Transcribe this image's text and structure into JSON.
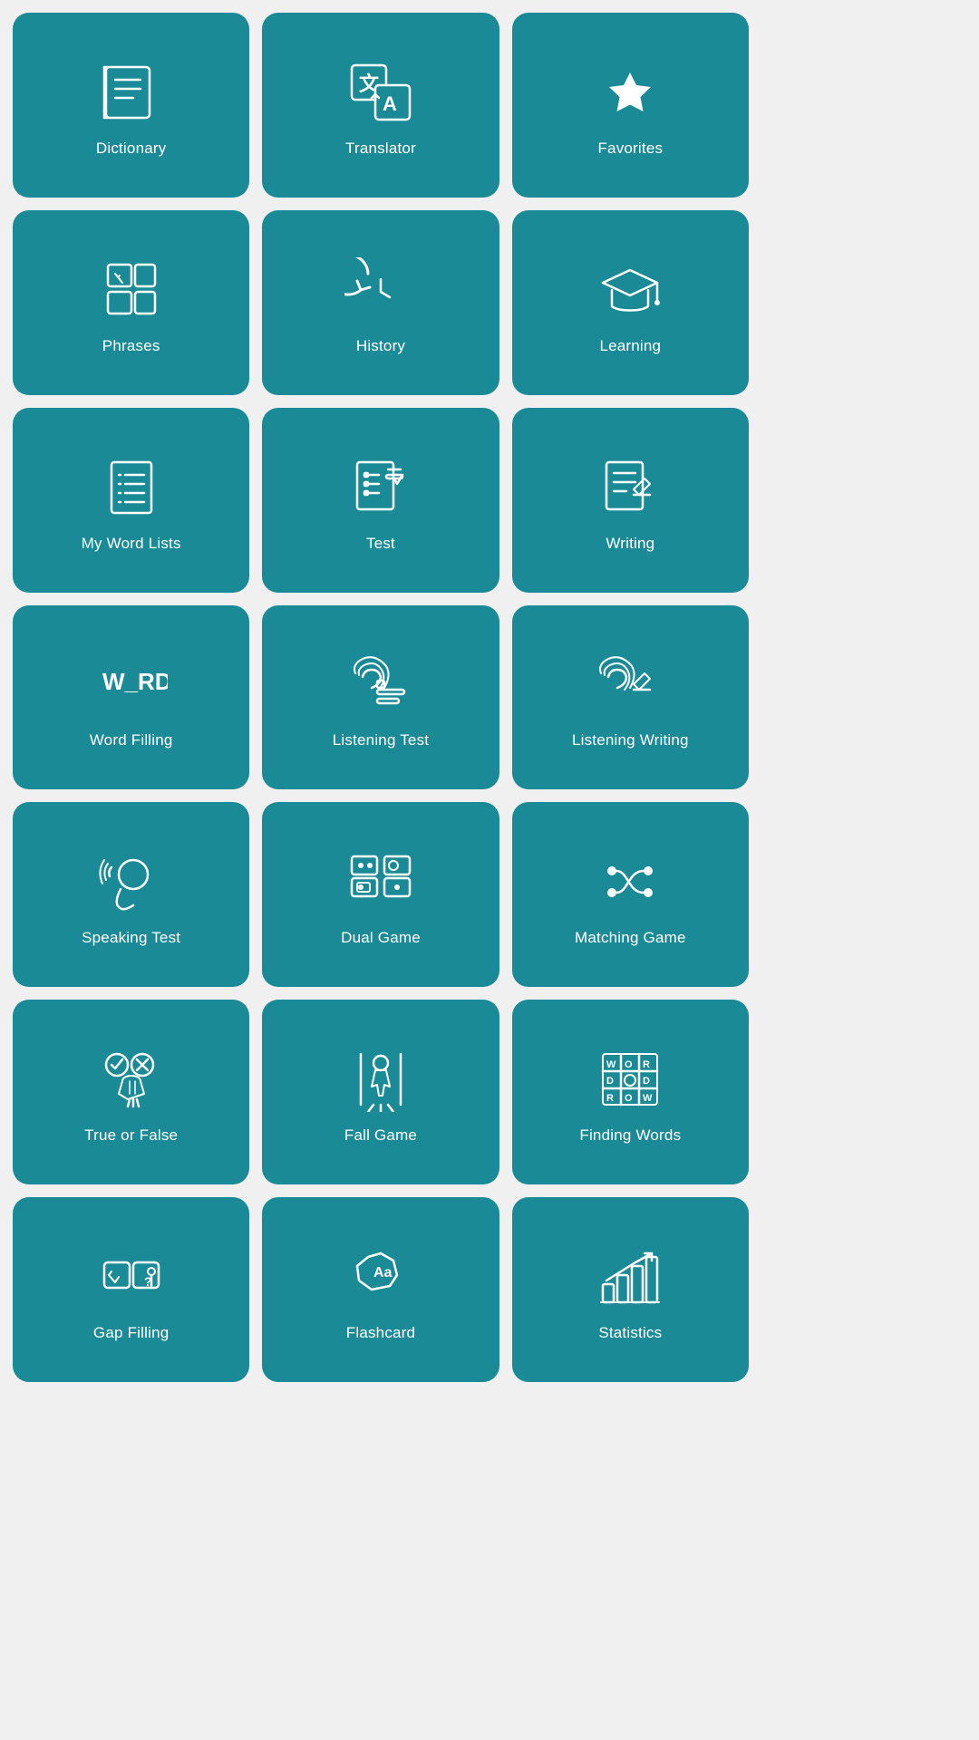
{
  "tiles": [
    {
      "id": "dictionary",
      "label": "Dictionary"
    },
    {
      "id": "translator",
      "label": "Translator"
    },
    {
      "id": "favorites",
      "label": "Favorites"
    },
    {
      "id": "phrases",
      "label": "Phrases"
    },
    {
      "id": "history",
      "label": "History"
    },
    {
      "id": "learning",
      "label": "Learning"
    },
    {
      "id": "my-word-lists",
      "label": "My Word Lists"
    },
    {
      "id": "test",
      "label": "Test"
    },
    {
      "id": "writing",
      "label": "Writing"
    },
    {
      "id": "word-filling",
      "label": "Word Filling"
    },
    {
      "id": "listening-test",
      "label": "Listening Test"
    },
    {
      "id": "listening-writing",
      "label": "Listening Writing"
    },
    {
      "id": "speaking-test",
      "label": "Speaking Test"
    },
    {
      "id": "dual-game",
      "label": "Dual Game"
    },
    {
      "id": "matching-game",
      "label": "Matching Game"
    },
    {
      "id": "true-or-false",
      "label": "True or False"
    },
    {
      "id": "fall-game",
      "label": "Fall Game"
    },
    {
      "id": "finding-words",
      "label": "Finding Words"
    },
    {
      "id": "gap-filling",
      "label": "Gap Filling"
    },
    {
      "id": "flashcard",
      "label": "Flashcard"
    },
    {
      "id": "statistics",
      "label": "Statistics"
    }
  ]
}
